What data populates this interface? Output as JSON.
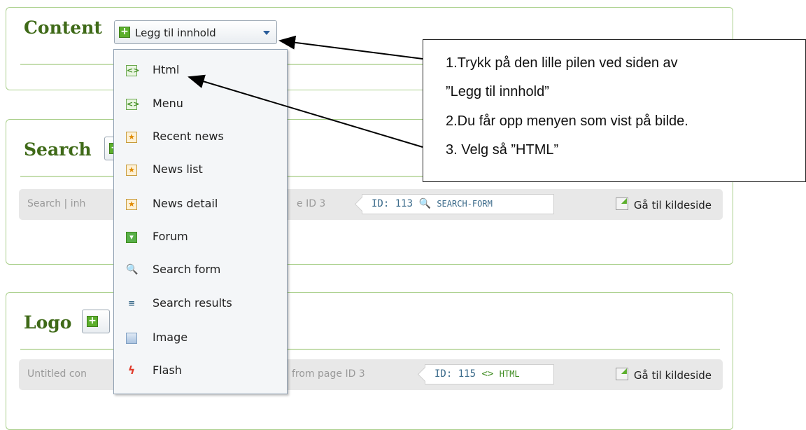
{
  "panels": {
    "content": {
      "title": "Content",
      "add_label": "Legg til innhold"
    },
    "search": {
      "title": "Search",
      "strip_left": "Search | inh",
      "strip_mid": "e ID 3",
      "id_text": "ID: 113",
      "id_type": "SEARCH-FORM",
      "goto_label": "Gå til kildeside"
    },
    "logo": {
      "title": "Logo",
      "strip_left": "Untitled con",
      "strip_mid": "from page ID 3",
      "id_text": "ID: 115",
      "id_type": "HTML",
      "goto_label": "Gå til kildeside"
    }
  },
  "menu": {
    "items": [
      {
        "label": "Html",
        "icon": "html-icon"
      },
      {
        "label": "Menu",
        "icon": "menu-icon"
      },
      {
        "label": "Recent news",
        "icon": "recent-news-icon"
      },
      {
        "label": "News list",
        "icon": "news-list-icon"
      },
      {
        "label": "News detail",
        "icon": "news-detail-icon"
      },
      {
        "label": "Forum",
        "icon": "forum-icon"
      },
      {
        "label": "Search form",
        "icon": "search-form-icon"
      },
      {
        "label": "Search results",
        "icon": "search-results-icon"
      },
      {
        "label": "Image",
        "icon": "image-icon"
      },
      {
        "label": "Flash",
        "icon": "flash-icon"
      }
    ]
  },
  "callout": {
    "lines": [
      "1.Trykk på den lille pilen ved siden av",
      "”Legg til innhold”",
      "2.Du får opp menyen som vist på bilde.",
      "3. Velg så ”HTML”"
    ]
  },
  "colors": {
    "panel_border": "#a9cf8a",
    "title": "#3f6a18",
    "accent_green": "#5caf2c"
  }
}
